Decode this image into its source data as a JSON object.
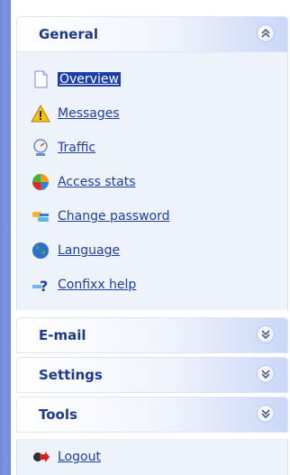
{
  "sections": {
    "general": {
      "title": "General",
      "toggle_icon": "chevron-up-double-icon"
    },
    "email": {
      "title": "E-mail",
      "toggle_icon": "chevron-down-double-icon"
    },
    "settings": {
      "title": "Settings",
      "toggle_icon": "chevron-down-double-icon"
    },
    "tools": {
      "title": "Tools",
      "toggle_icon": "chevron-down-double-icon"
    }
  },
  "general_items": [
    {
      "label": "Overview",
      "icon": "document-icon",
      "active": true
    },
    {
      "label": "Messages",
      "icon": "warning-icon",
      "active": false
    },
    {
      "label": "Traffic",
      "icon": "gauge-icon",
      "active": false
    },
    {
      "label": "Access stats",
      "icon": "pie-chart-icon",
      "active": false
    },
    {
      "label": "Change password",
      "icon": "keys-icon",
      "active": false
    },
    {
      "label": "Language",
      "icon": "globe-icon",
      "active": false
    },
    {
      "label": "Confixx help",
      "icon": "help-icon",
      "active": false
    }
  ],
  "logout": {
    "label": "Logout",
    "icon": "logout-arrow-icon"
  },
  "colors": {
    "header_text": "#1d3a8a",
    "link": "#1f3f9e",
    "active_bg": "#1b3ea8",
    "left_strip": "#6d89d8"
  }
}
